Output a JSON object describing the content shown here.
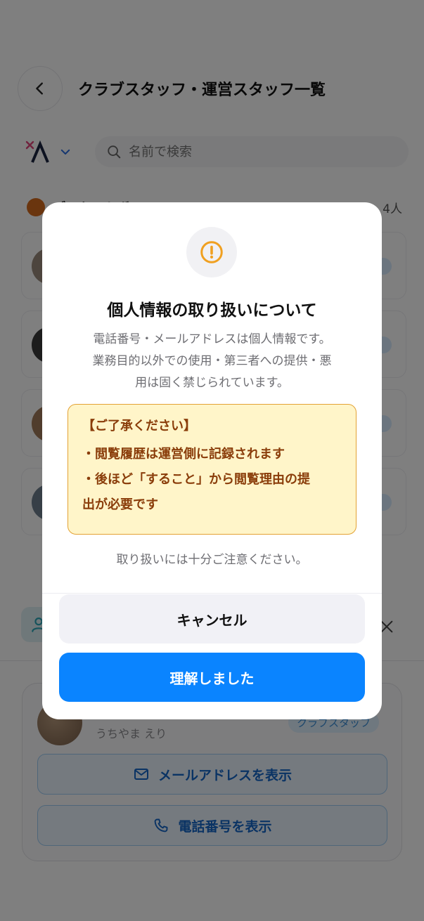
{
  "header": {
    "title": "クラブスタッフ・運営スタッフ一覧",
    "back_icon": "chevron-left-icon"
  },
  "filters": {
    "language_icon": "translate-icon",
    "search_placeholder": "名前で検索"
  },
  "group": {
    "name": "ゴスケットボール",
    "count": "4人"
  },
  "staff_detail": {
    "kana_name": "うちやま えり",
    "role": "クラブスタッフ",
    "email_button": "メールアドレスを表示",
    "phone_button": "電話番号を表示"
  },
  "modal": {
    "icon": "alert-circle-icon",
    "title": "個人情報の取り扱いについて",
    "description_lines": [
      "電話番号・メールアドレスは個人情報です。",
      "業務目的以外での使用・第三者への提供・悪",
      "用は固く禁じられています。"
    ],
    "notice": {
      "heading": "【ご了承ください】",
      "items": [
        "・閲覧履歴は運営側に記録されます",
        "・後ほど「すること」から閲覧理由の提",
        "出が必要です"
      ]
    },
    "note": "取り扱いには十分ご注意ください。",
    "cancel_label": "キャンセル",
    "confirm_label": "理解しました"
  },
  "colors": {
    "primary": "#0a84ff",
    "warning_bg": "#fff5c9",
    "warning_border": "#e3a234",
    "warning_text": "#8a3d0a",
    "alert_icon": "#f0a020"
  }
}
